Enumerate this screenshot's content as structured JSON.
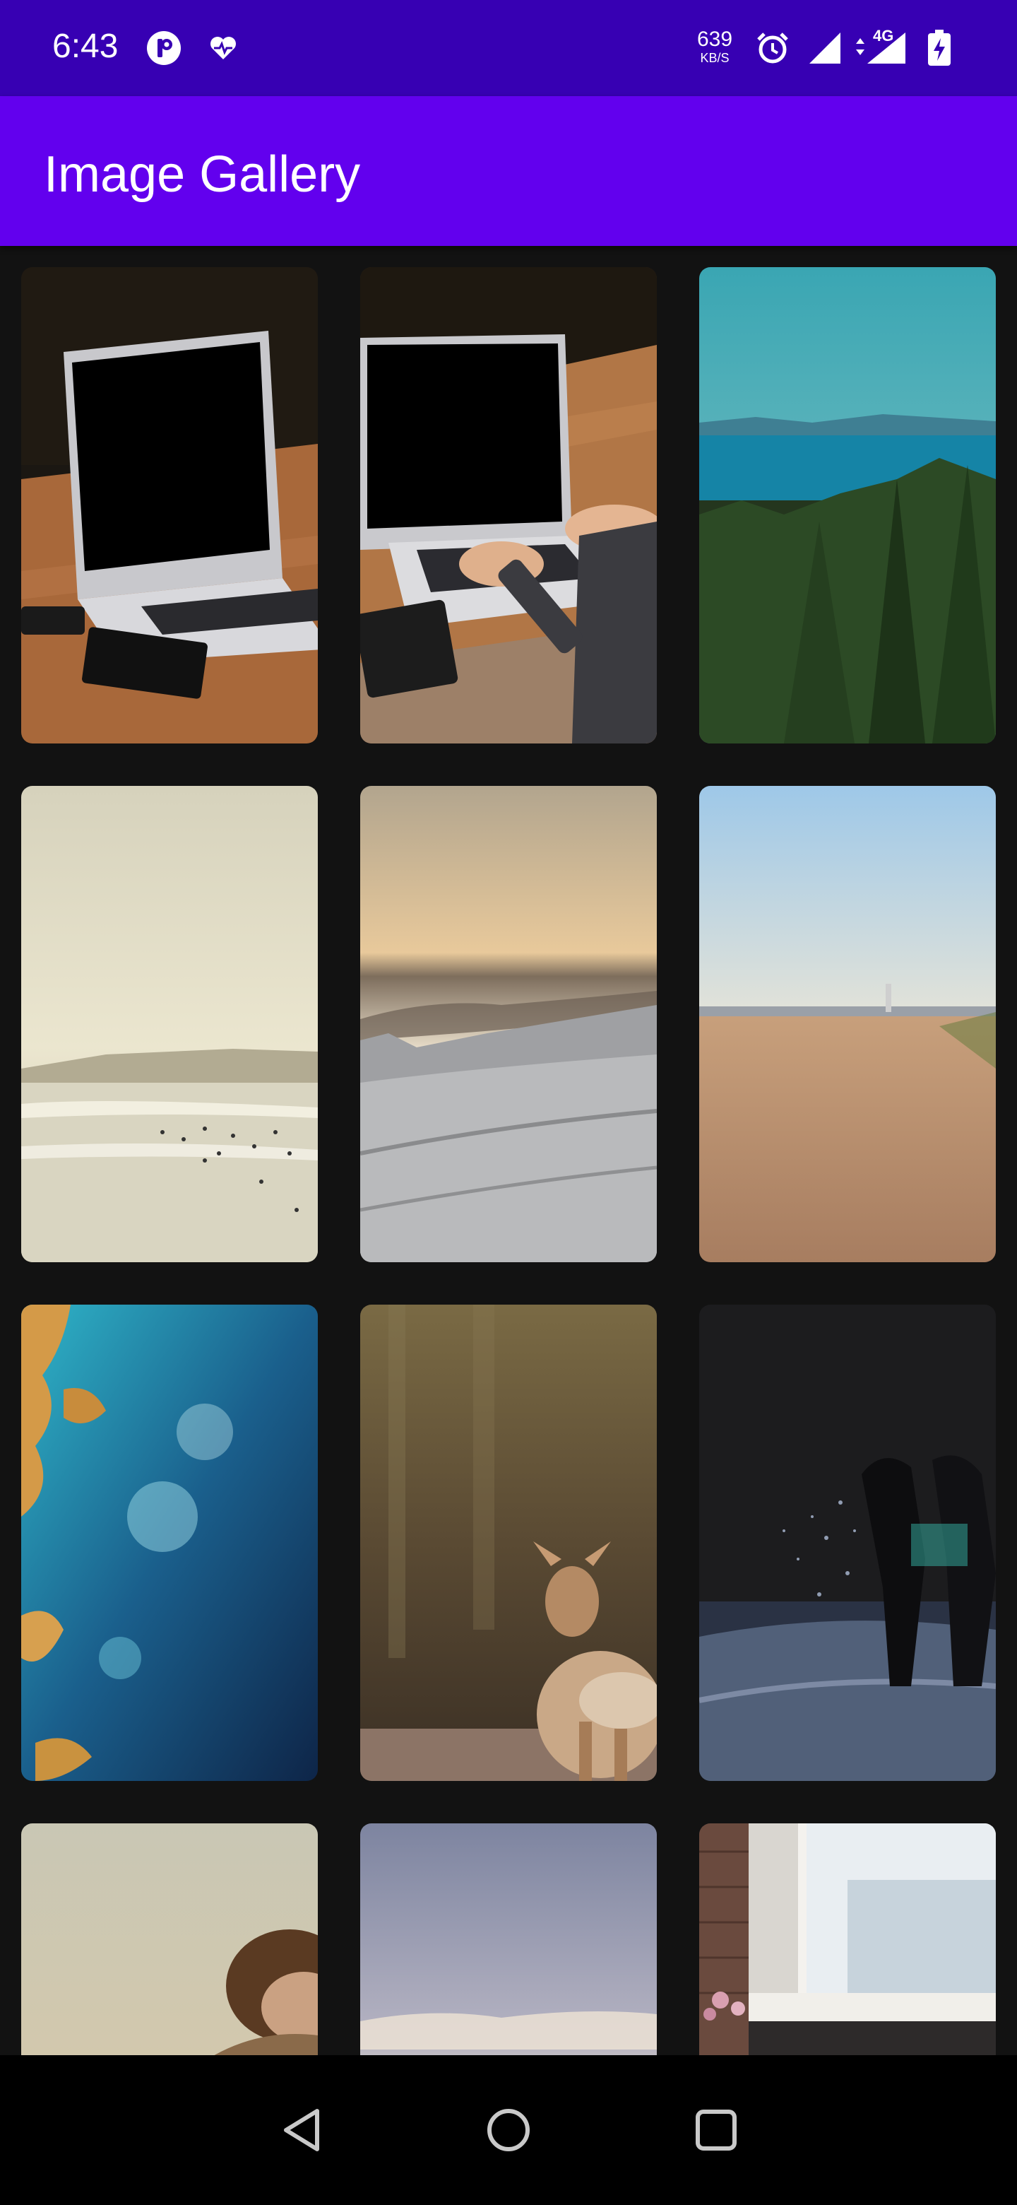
{
  "status_bar": {
    "time": "6:43",
    "speed_value": "639",
    "speed_unit": "KB/S",
    "network_type": "4G",
    "icons": [
      "app-notification-icon",
      "health-icon",
      "alarm-icon",
      "signal-icon",
      "mobile-network-icon",
      "battery-charging-icon"
    ]
  },
  "app_bar": {
    "title": "Image Gallery"
  },
  "gallery": {
    "columns": 3,
    "images": [
      {
        "subject": "laptop on wooden table with notebook and phone"
      },
      {
        "subject": "person typing on laptop on wooden table"
      },
      {
        "subject": "sea view over green trees"
      },
      {
        "subject": "hazy beach with people in the water"
      },
      {
        "subject": "snowy mountain slope at sunset"
      },
      {
        "subject": "sandy beach with blue sky"
      },
      {
        "subject": "aerial view of turquoise ocean and gold sands"
      },
      {
        "subject": "young deer in a forest"
      },
      {
        "subject": "silhouette with water splash at night"
      },
      {
        "subject": "person wearing a scarf"
      },
      {
        "subject": "cloudy sky"
      },
      {
        "subject": "window with brick wall and plants"
      }
    ]
  },
  "nav_bar": {
    "buttons": [
      "back",
      "home",
      "recents"
    ]
  },
  "colors": {
    "status_bar": "#3700b3",
    "app_bar": "#6200ee",
    "background": "#121212",
    "nav_bar": "#000000"
  }
}
